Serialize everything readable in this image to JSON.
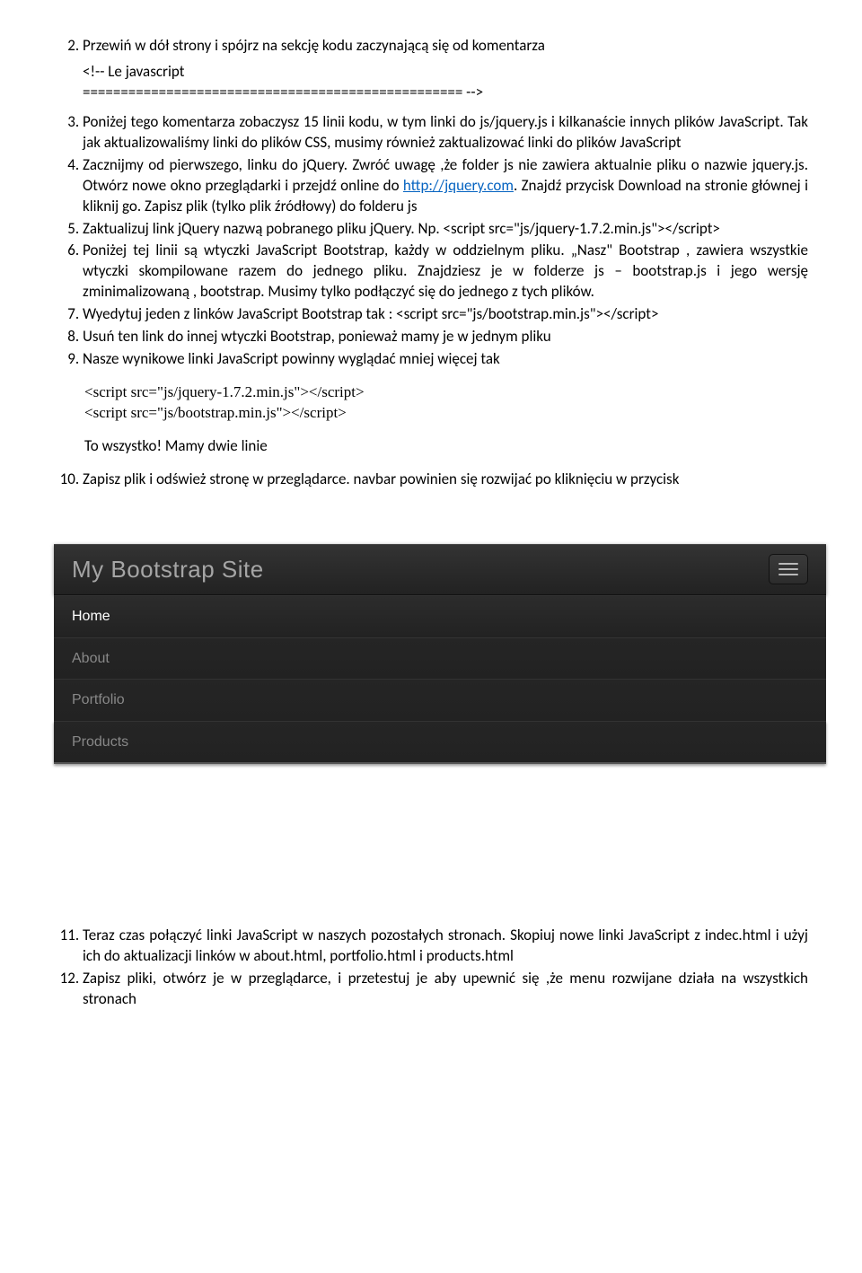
{
  "items": {
    "i2": {
      "num": "2.",
      "a": "Przewiń w dół strony i spójrz na sekcję kodu zaczynającą się od komentarza",
      "code": "<!-- Le javascript\n================================================== -->"
    },
    "i3": {
      "num": "3.",
      "a": "Poniżej tego komentarza zobaczysz 15 linii kodu, w tym linki do js/jquery.js i kilkanaście innych plików JavaScript. Tak jak aktualizowaliśmy linki do plików CSS, musimy również zaktualizować linki do plików JavaScript"
    },
    "i4": {
      "num": "4.",
      "a": "Zacznijmy od pierwszego, linku do jQuery. Zwróć uwagę ,że folder js nie zawiera aktualnie pliku o nazwie jquery.js. Otwórz nowe okno przeglądarki i przejdź online do ",
      "link": "http://jquery.com",
      "b": ". Znajdź przycisk Download na stronie głównej i kliknij go. Zapisz plik (tylko plik źródłowy) do folderu js"
    },
    "i5": {
      "num": "5.",
      "text": "Zaktualizuj link jQuery nazwą pobranego pliku jQuery. Np. <script src=\"js/jquery-1.7.2.min.js\"></script>"
    },
    "i6": {
      "num": "6.",
      "text": "Poniżej tej linii są wtyczki JavaScript Bootstrap, każdy w oddzielnym pliku. „Nasz\" Bootstrap , zawiera wszystkie wtyczki skompilowane razem do jednego pliku. Znajdziesz je w folderze js – bootstrap.js i jego wersję zminimalizowaną , bootstrap. Musimy tylko podłączyć się do jednego z tych plików."
    },
    "i7": {
      "num": "7.",
      "text": "Wyedytuj jeden z linków JavaScript Bootstrap tak  : <script src=\"js/bootstrap.min.js\"></script>"
    },
    "i8": {
      "num": "8.",
      "text": "Usuń ten link do innej wtyczki Bootstrap, ponieważ mamy je w jednym pliku"
    },
    "i9": {
      "num": "9.",
      "text": "Nasze wynikowe linki JavaScript powinny wyglądać mniej więcej tak"
    },
    "scriptblock": {
      "l1": "<script src=\"js/jquery-1.7.2.min.js\"></script>",
      "l2": "<script src=\"js/bootstrap.min.js\"></script>"
    },
    "closing": "To wszystko! Mamy dwie linie",
    "i10": {
      "num": "10.",
      "text": "Zapisz plik i odśwież stronę w przeglądarce.  navbar powinien się rozwijać po kliknięciu w przycisk"
    },
    "i11": {
      "num": "11.",
      "text": "Teraz czas  połączyć linki JavaScript w naszych pozostałych  stronach. Skopiuj nowe linki JavaScript z indec.html i użyj ich do aktualizacji linków w about.html, portfolio.html i products.html"
    },
    "i12": {
      "num": "12.",
      "text": "Zapisz pliki, otwórz je w przeglądarce, i przetestuj je aby upewnić się ,że menu rozwijane działa na wszystkich stronach"
    }
  },
  "navbar": {
    "brand": "My Bootstrap Site",
    "items": [
      "Home",
      "About",
      "Portfolio",
      "Products"
    ]
  }
}
